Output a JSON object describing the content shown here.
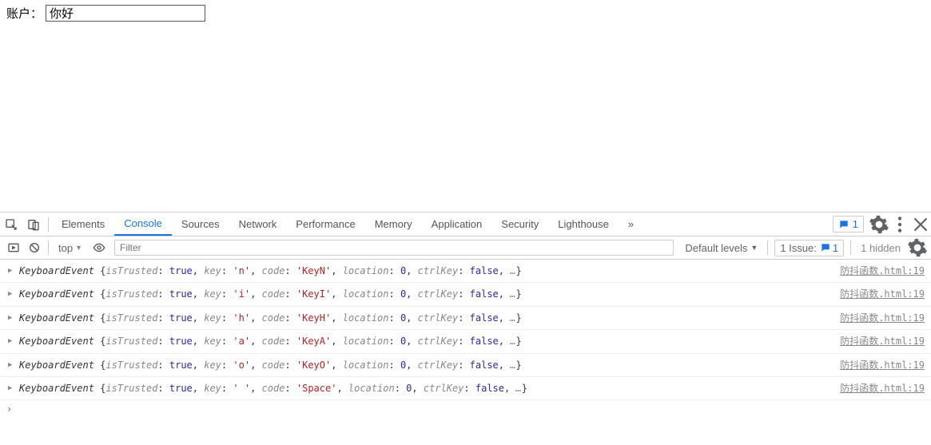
{
  "page": {
    "label": "账户：",
    "input_value": "你好"
  },
  "tabs": {
    "items": [
      "Elements",
      "Console",
      "Sources",
      "Network",
      "Performance",
      "Memory",
      "Application",
      "Security",
      "Lighthouse"
    ],
    "active": "Console",
    "more_glyph": "»",
    "issues_badge": "1"
  },
  "filter": {
    "context": "top",
    "placeholder": "Filter",
    "levels": "Default levels",
    "issue_label": "1 Issue:",
    "issue_count": "1",
    "hidden": "1 hidden"
  },
  "logs": [
    {
      "cls": "KeyboardEvent",
      "isTrusted": "true",
      "key": "'n'",
      "code": "'KeyN'",
      "loc": "0",
      "ctrl": "false",
      "src": "防抖函数.html:19"
    },
    {
      "cls": "KeyboardEvent",
      "isTrusted": "true",
      "key": "'i'",
      "code": "'KeyI'",
      "loc": "0",
      "ctrl": "false",
      "src": "防抖函数.html:19"
    },
    {
      "cls": "KeyboardEvent",
      "isTrusted": "true",
      "key": "'h'",
      "code": "'KeyH'",
      "loc": "0",
      "ctrl": "false",
      "src": "防抖函数.html:19"
    },
    {
      "cls": "KeyboardEvent",
      "isTrusted": "true",
      "key": "'a'",
      "code": "'KeyA'",
      "loc": "0",
      "ctrl": "false",
      "src": "防抖函数.html:19"
    },
    {
      "cls": "KeyboardEvent",
      "isTrusted": "true",
      "key": "'o'",
      "code": "'KeyO'",
      "loc": "0",
      "ctrl": "false",
      "src": "防抖函数.html:19"
    },
    {
      "cls": "KeyboardEvent",
      "isTrusted": "true",
      "key": "' '",
      "code": "'Space'",
      "loc": "0",
      "ctrl": "false",
      "src": "防抖函数.html:19"
    }
  ],
  "tokens": {
    "isTrusted": "isTrusted",
    "key": "key",
    "code": "code",
    "location": "location",
    "ctrlKey": "ctrlKey",
    "ellipsis": "…",
    "open": "{",
    "close": "}",
    "comma": ", ",
    "colon": ": "
  }
}
